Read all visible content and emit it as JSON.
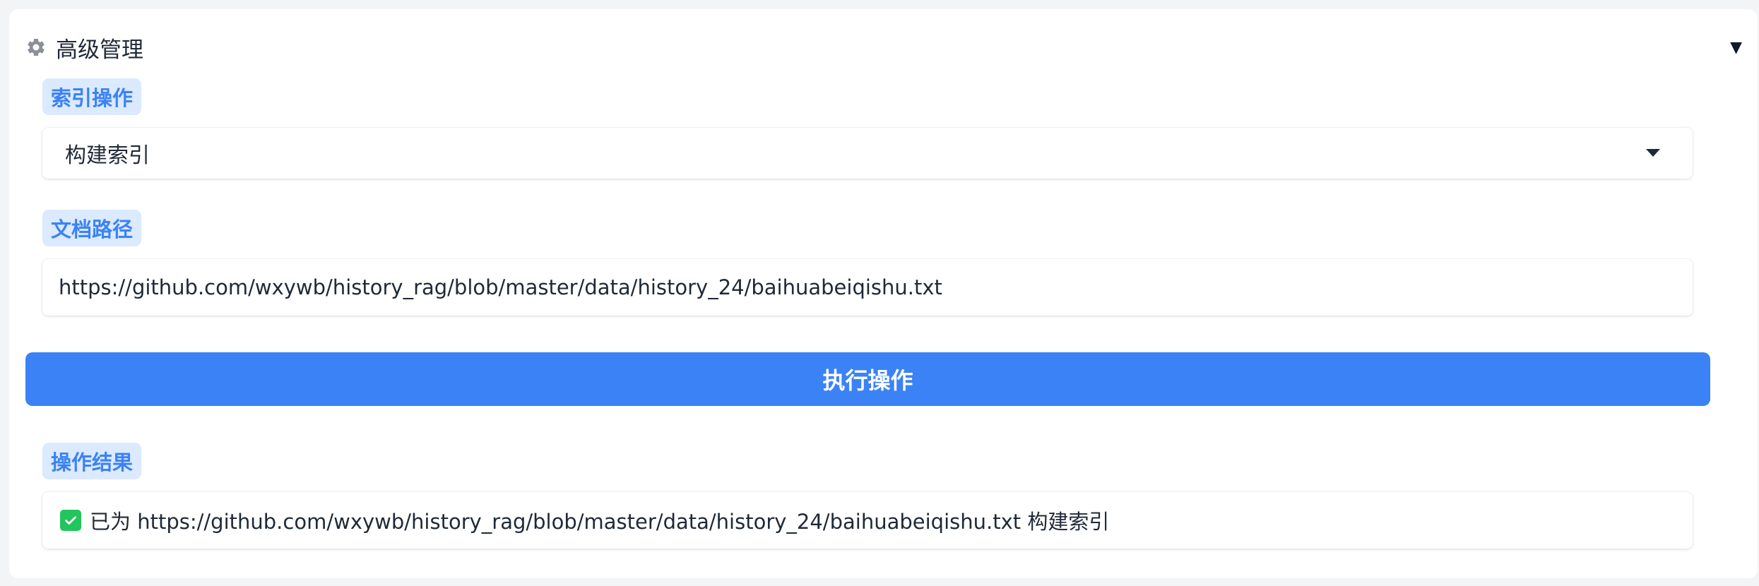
{
  "accordion": {
    "title": "高级管理",
    "icon": "gear-icon",
    "expanded_indicator": "▼"
  },
  "index_operation": {
    "label": "索引操作",
    "selected": "构建索引"
  },
  "doc_path": {
    "label": "文档路径",
    "value": "https://github.com/wxywb/history_rag/blob/master/data/history_24/baihuabeiqishu.txt"
  },
  "execute": {
    "label": "执行操作"
  },
  "result": {
    "label": "操作结果",
    "icon": "check-icon",
    "text": "已为 https://github.com/wxywb/history_rag/blob/master/data/history_24/baihuabeiqishu.txt 构建索引"
  },
  "colors": {
    "accent": "#3b82f6",
    "chip_bg": "#dbeafe",
    "success": "#22c55e"
  }
}
